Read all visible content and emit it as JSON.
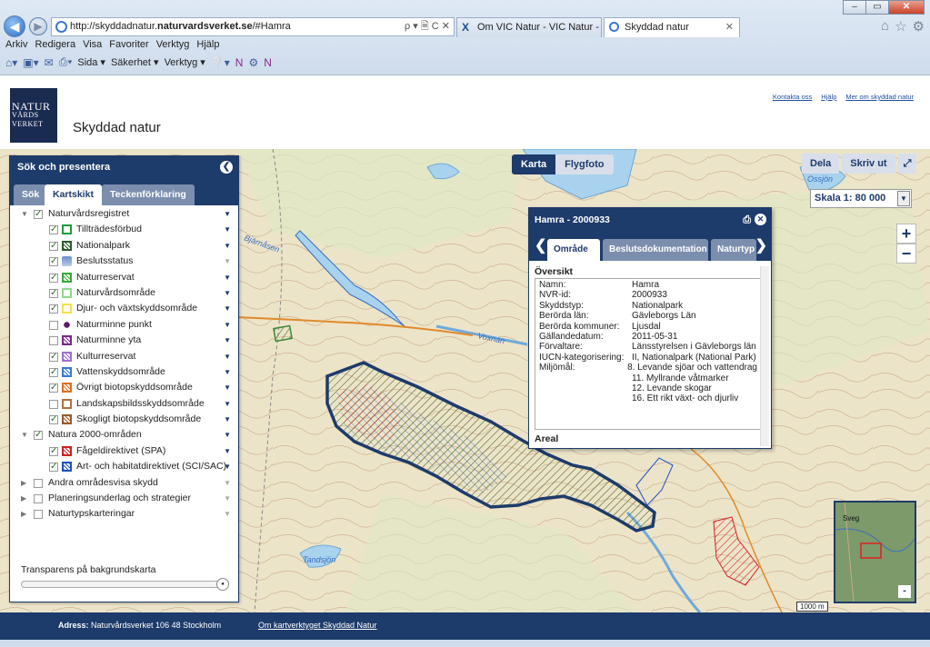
{
  "browser": {
    "url_prefix": "http://skyddadnatur.",
    "url_domain": "naturvardsverket.se",
    "url_suffix": "/#Hamra",
    "url_controls": "ρ ▾ 🗎 C ✕",
    "tabs": [
      {
        "label": "Om VIC Natur - VIC Natur - VI...",
        "active": false
      },
      {
        "label": "Skyddad natur",
        "active": true
      }
    ],
    "tab_close": "✕",
    "menu": [
      "Arkiv",
      "Redigera",
      "Visa",
      "Favoriter",
      "Verktyg",
      "Hjälp"
    ],
    "commands": [
      "Sida ▾",
      "Säkerhet ▾",
      "Verktyg ▾"
    ],
    "window_controls": [
      "–",
      "▭",
      "✕"
    ]
  },
  "header": {
    "logo_line1": "NATUR",
    "logo_line2": "VÅRDS",
    "logo_line3": "VERKET",
    "site_title": "Skyddad natur",
    "links": [
      "Kontakta oss",
      "Hjälp",
      "Mer om skyddad natur"
    ]
  },
  "panel": {
    "title": "Sök och presentera",
    "close_icon": "chevron-left-icon",
    "tabs": [
      {
        "label": "Sök",
        "active": false
      },
      {
        "label": "Kartskikt",
        "active": true
      },
      {
        "label": "Teckenförklaring",
        "active": false
      }
    ],
    "layers": [
      {
        "label": "Naturvårdsregistret",
        "level": 0,
        "expanded": true,
        "checked": true,
        "dd": true
      },
      {
        "label": "Tillträdesförbud",
        "level": 1,
        "checked": true,
        "swatch": "#1f9b3a",
        "pattern": "outline",
        "dd": true
      },
      {
        "label": "Nationalpark",
        "level": 1,
        "checked": true,
        "swatch": "#2a5a2a",
        "pattern": "hatch",
        "dd": true
      },
      {
        "label": "Beslutsstatus",
        "level": 1,
        "checked": true,
        "swatch": "#6a8fc8",
        "pattern": "stack",
        "dd": false
      },
      {
        "label": "Naturreservat",
        "level": 1,
        "checked": true,
        "swatch": "#3aa83a",
        "pattern": "hatch",
        "dd": true
      },
      {
        "label": "Naturvårdsområde",
        "level": 1,
        "checked": true,
        "swatch": "#8fd88f",
        "pattern": "outline",
        "dd": true
      },
      {
        "label": "Djur- och växtskyddsområde",
        "level": 1,
        "checked": true,
        "swatch": "#f2e24a",
        "pattern": "outline",
        "dd": true
      },
      {
        "label": "Naturminne punkt",
        "level": 1,
        "checked": false,
        "swatch": "#5a1a6a",
        "pattern": "dot",
        "dd": true
      },
      {
        "label": "Naturminne yta",
        "level": 1,
        "checked": false,
        "swatch": "#7a2a8a",
        "pattern": "hatch",
        "dd": true
      },
      {
        "label": "Kulturreservat",
        "level": 1,
        "checked": true,
        "swatch": "#a070d0",
        "pattern": "hatch",
        "dd": true
      },
      {
        "label": "Vattenskyddsområde",
        "level": 1,
        "checked": true,
        "swatch": "#3a7ad0",
        "pattern": "hatch",
        "dd": true
      },
      {
        "label": "Övrigt biotopskyddsområde",
        "level": 1,
        "checked": true,
        "swatch": "#e07020",
        "pattern": "hatch",
        "dd": true
      },
      {
        "label": "Landskapsbildsskyddsområde",
        "level": 1,
        "checked": false,
        "swatch": "#b07040",
        "pattern": "outline",
        "dd": true
      },
      {
        "label": "Skogligt biotopskyddsområde",
        "level": 1,
        "checked": true,
        "swatch": "#9a5a2a",
        "pattern": "hatch",
        "dd": true
      },
      {
        "label": "Natura 2000-områden",
        "level": 0,
        "expanded": true,
        "checked": true,
        "dd": true
      },
      {
        "label": "Fågeldirektivet (SPA)",
        "level": 1,
        "checked": true,
        "swatch": "#d02020",
        "pattern": "hatch",
        "dd": true
      },
      {
        "label": "Art- och habitatdirektivet (SCI/SAC)",
        "level": 1,
        "checked": true,
        "swatch": "#2050c0",
        "pattern": "hatch",
        "dd": true
      },
      {
        "label": "Andra områdesvisa skydd",
        "level": 0,
        "expanded": false,
        "checked": false,
        "dd": false
      },
      {
        "label": "Planeringsunderlag och strategier",
        "level": 0,
        "expanded": false,
        "checked": false,
        "dd": false
      },
      {
        "label": "Naturtypskarteringar",
        "level": 0,
        "expanded": false,
        "checked": false,
        "dd": false
      }
    ],
    "transparency_label": "Transparens på bakgrundskarta",
    "transparency_value": 1.0
  },
  "map": {
    "type_buttons": [
      {
        "label": "Karta",
        "active": true
      },
      {
        "label": "Flygfoto",
        "active": false
      }
    ],
    "right_buttons": [
      "Dela",
      "Skriv ut"
    ],
    "scale_label": "Skala 1:",
    "scale_value": "80 000",
    "zoom_in": "+",
    "zoom_out": "−",
    "place_labels": [
      "Bjärnåsen",
      "Voxnan",
      "Tandsjön",
      "Ossjön"
    ],
    "scalebar_label": "1000 m",
    "minimap_label": "Sveg",
    "minimap_toggle": "-"
  },
  "popup": {
    "title": "Hamra - 2000933",
    "tabs": [
      {
        "label": "Område",
        "active": true
      },
      {
        "label": "Beslutsdokumentation",
        "active": false
      },
      {
        "label": "Naturtyp",
        "active": false
      }
    ],
    "section": "Översikt",
    "rows": [
      {
        "k": "Namn:",
        "v": "Hamra"
      },
      {
        "k": "NVR-id:",
        "v": "2000933"
      },
      {
        "k": "Skyddstyp:",
        "v": "Nationalpark"
      },
      {
        "k": "Berörda län:",
        "v": "Gävleborgs Län"
      },
      {
        "k": "Berörda kommuner:",
        "v": "Ljusdal"
      },
      {
        "k": "Gällandedatum:",
        "v": "2011-05-31"
      },
      {
        "k": "Förvaltare:",
        "v": "Länsstyrelsen i Gävleborgs län"
      },
      {
        "k": "IUCN-kategorisering:",
        "v": "II, Nationalpark (National Park)"
      },
      {
        "k": "Miljömål:",
        "v": "8. Levande sjöar och vattendrag"
      },
      {
        "k": "",
        "v": "11. Myllrande våtmarker"
      },
      {
        "k": "",
        "v": "12. Levande skogar"
      },
      {
        "k": "",
        "v": "16. Ett rikt växt- och djurliv"
      }
    ],
    "next_section": "Areal"
  },
  "footer": {
    "address_label": "Adress:",
    "address": "Naturvårdsverket 106 48 Stockholm",
    "link": "Om kartverktyget Skyddad Natur"
  }
}
